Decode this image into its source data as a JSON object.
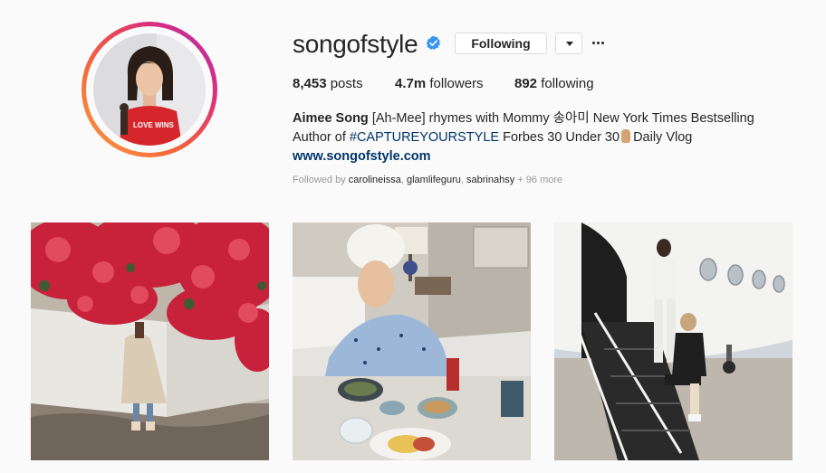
{
  "profile": {
    "username": "songofstyle",
    "follow_label": "Following",
    "stats": {
      "posts_count": "8,453",
      "posts_label": "posts",
      "followers_count": "4.7m",
      "followers_label": "followers",
      "following_count": "892",
      "following_label": "following"
    },
    "bio": {
      "name": "Aimee Song",
      "line1_text": "[Ah-Mee] rhymes with Mommy 송아미 New York Times Bestselling",
      "line2_prefix": "Author of",
      "hashtag": "#CAPTUREYOURSTYLE",
      "line2_suffix": "Forbes 30 Under 30",
      "line2_end": "Daily Vlog",
      "website": "www.songofstyle.com"
    },
    "followed_by": {
      "prefix": "Followed by",
      "accounts": [
        "carolineissa",
        "glamlifeguru",
        "sabrinahsy"
      ],
      "more": "+ 96 more"
    },
    "avatar_shirt_text": "LOVE WINS"
  },
  "colors": {
    "verified_blue": "#3897f0",
    "link": "#003569",
    "muted": "#999999",
    "border": "#dbdbdb"
  },
  "icons": {
    "verified": "verified-badge-icon",
    "dropdown": "chevron-down-icon",
    "more": "more-options-icon"
  },
  "posts": [
    {
      "subject": "woman in trench coat in front of red bougainvillea wall"
    },
    {
      "subject": "woman with towel on head eating breakfast in bed"
    },
    {
      "subject": "two women on private jet stairs"
    }
  ]
}
